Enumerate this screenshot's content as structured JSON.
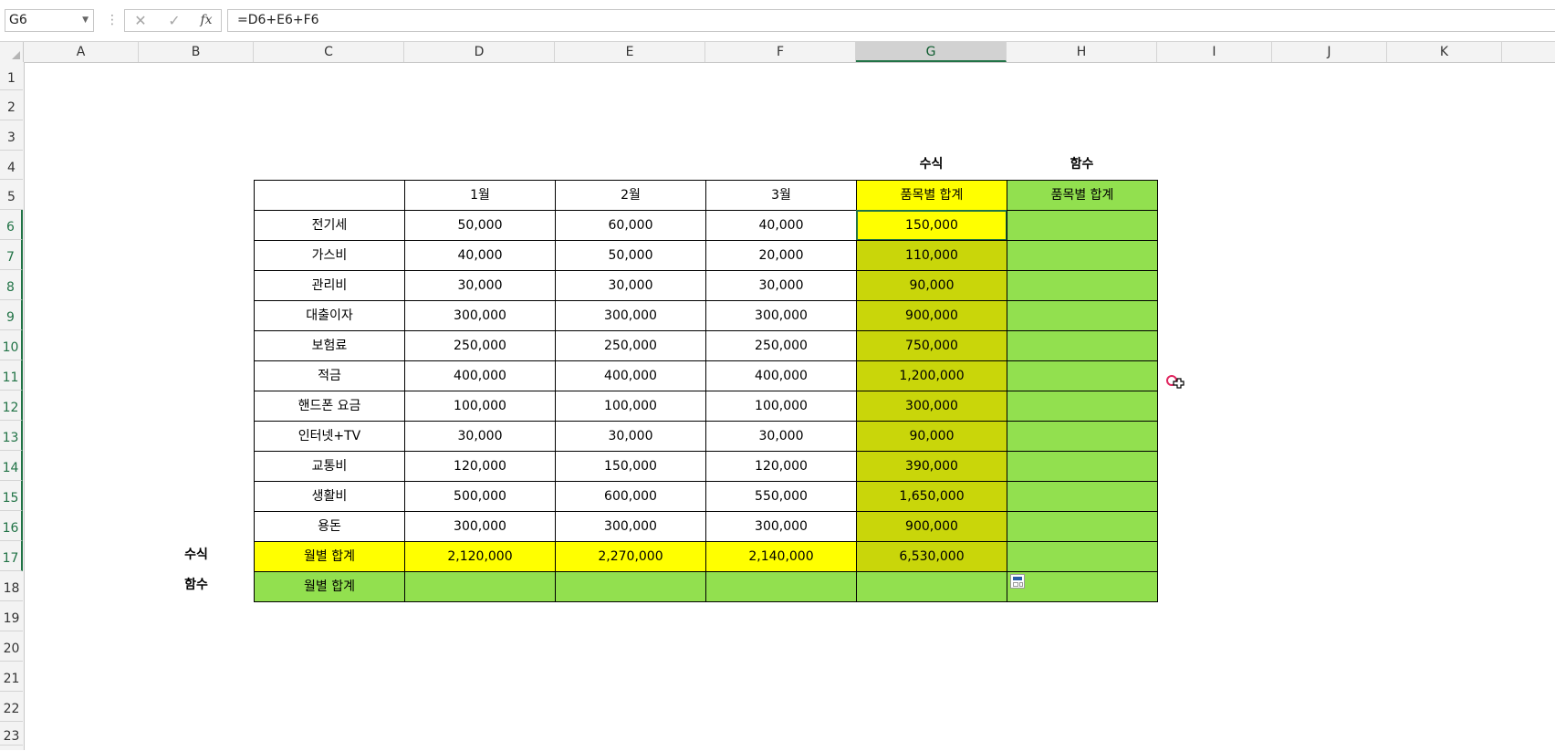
{
  "formula_bar": {
    "name_box": "G6",
    "cancel_symbol": "✕",
    "enter_symbol": "✓",
    "fx_symbol": "fx",
    "formula": "=D6+E6+F6"
  },
  "columns": [
    "A",
    "B",
    "C",
    "D",
    "E",
    "F",
    "G",
    "H",
    "I",
    "J",
    "K"
  ],
  "rows": [
    "1",
    "2",
    "3",
    "4",
    "5",
    "6",
    "7",
    "8",
    "9",
    "10",
    "11",
    "12",
    "13",
    "14",
    "15",
    "16",
    "17",
    "18",
    "19",
    "20",
    "21",
    "22",
    "23"
  ],
  "selection": {
    "active_cell": "G6",
    "selected_column": "G",
    "selected_rows": "6-17"
  },
  "table": {
    "label_formula_top": "수식",
    "label_function_top": "함수",
    "header": [
      "",
      "1월",
      "2월",
      "3월",
      "품목별 합계",
      "품목별 합계"
    ],
    "items": [
      {
        "name": "전기세",
        "jan": "50,000",
        "feb": "60,000",
        "mar": "40,000",
        "total": "150,000"
      },
      {
        "name": "가스비",
        "jan": "40,000",
        "feb": "50,000",
        "mar": "20,000",
        "total": "110,000"
      },
      {
        "name": "관리비",
        "jan": "30,000",
        "feb": "30,000",
        "mar": "30,000",
        "total": "90,000"
      },
      {
        "name": "대출이자",
        "jan": "300,000",
        "feb": "300,000",
        "mar": "300,000",
        "total": "900,000"
      },
      {
        "name": "보험료",
        "jan": "250,000",
        "feb": "250,000",
        "mar": "250,000",
        "total": "750,000"
      },
      {
        "name": "적금",
        "jan": "400,000",
        "feb": "400,000",
        "mar": "400,000",
        "total": "1,200,000"
      },
      {
        "name": "핸드폰 요금",
        "jan": "100,000",
        "feb": "100,000",
        "mar": "100,000",
        "total": "300,000"
      },
      {
        "name": "인터넷+TV",
        "jan": "30,000",
        "feb": "30,000",
        "mar": "30,000",
        "total": "90,000"
      },
      {
        "name": "교통비",
        "jan": "120,000",
        "feb": "150,000",
        "mar": "120,000",
        "total": "390,000"
      },
      {
        "name": "생활비",
        "jan": "500,000",
        "feb": "600,000",
        "mar": "550,000",
        "total": "1,650,000"
      },
      {
        "name": "용돈",
        "jan": "300,000",
        "feb": "300,000",
        "mar": "300,000",
        "total": "900,000"
      }
    ],
    "formula_row": {
      "side_label": "수식",
      "name": "월별 합계",
      "jan": "2,120,000",
      "feb": "2,270,000",
      "mar": "2,140,000",
      "total": "6,530,000"
    },
    "function_row": {
      "side_label": "함수",
      "name": "월별 합계"
    }
  },
  "colors": {
    "yellow": "#ffff00",
    "olive_selected": "#c9d60a",
    "green": "#92e04f",
    "excel_green": "#217346"
  },
  "icons": {
    "quick_analysis": "quick-analysis-icon",
    "cursor": "cell-select-cursor-icon"
  }
}
